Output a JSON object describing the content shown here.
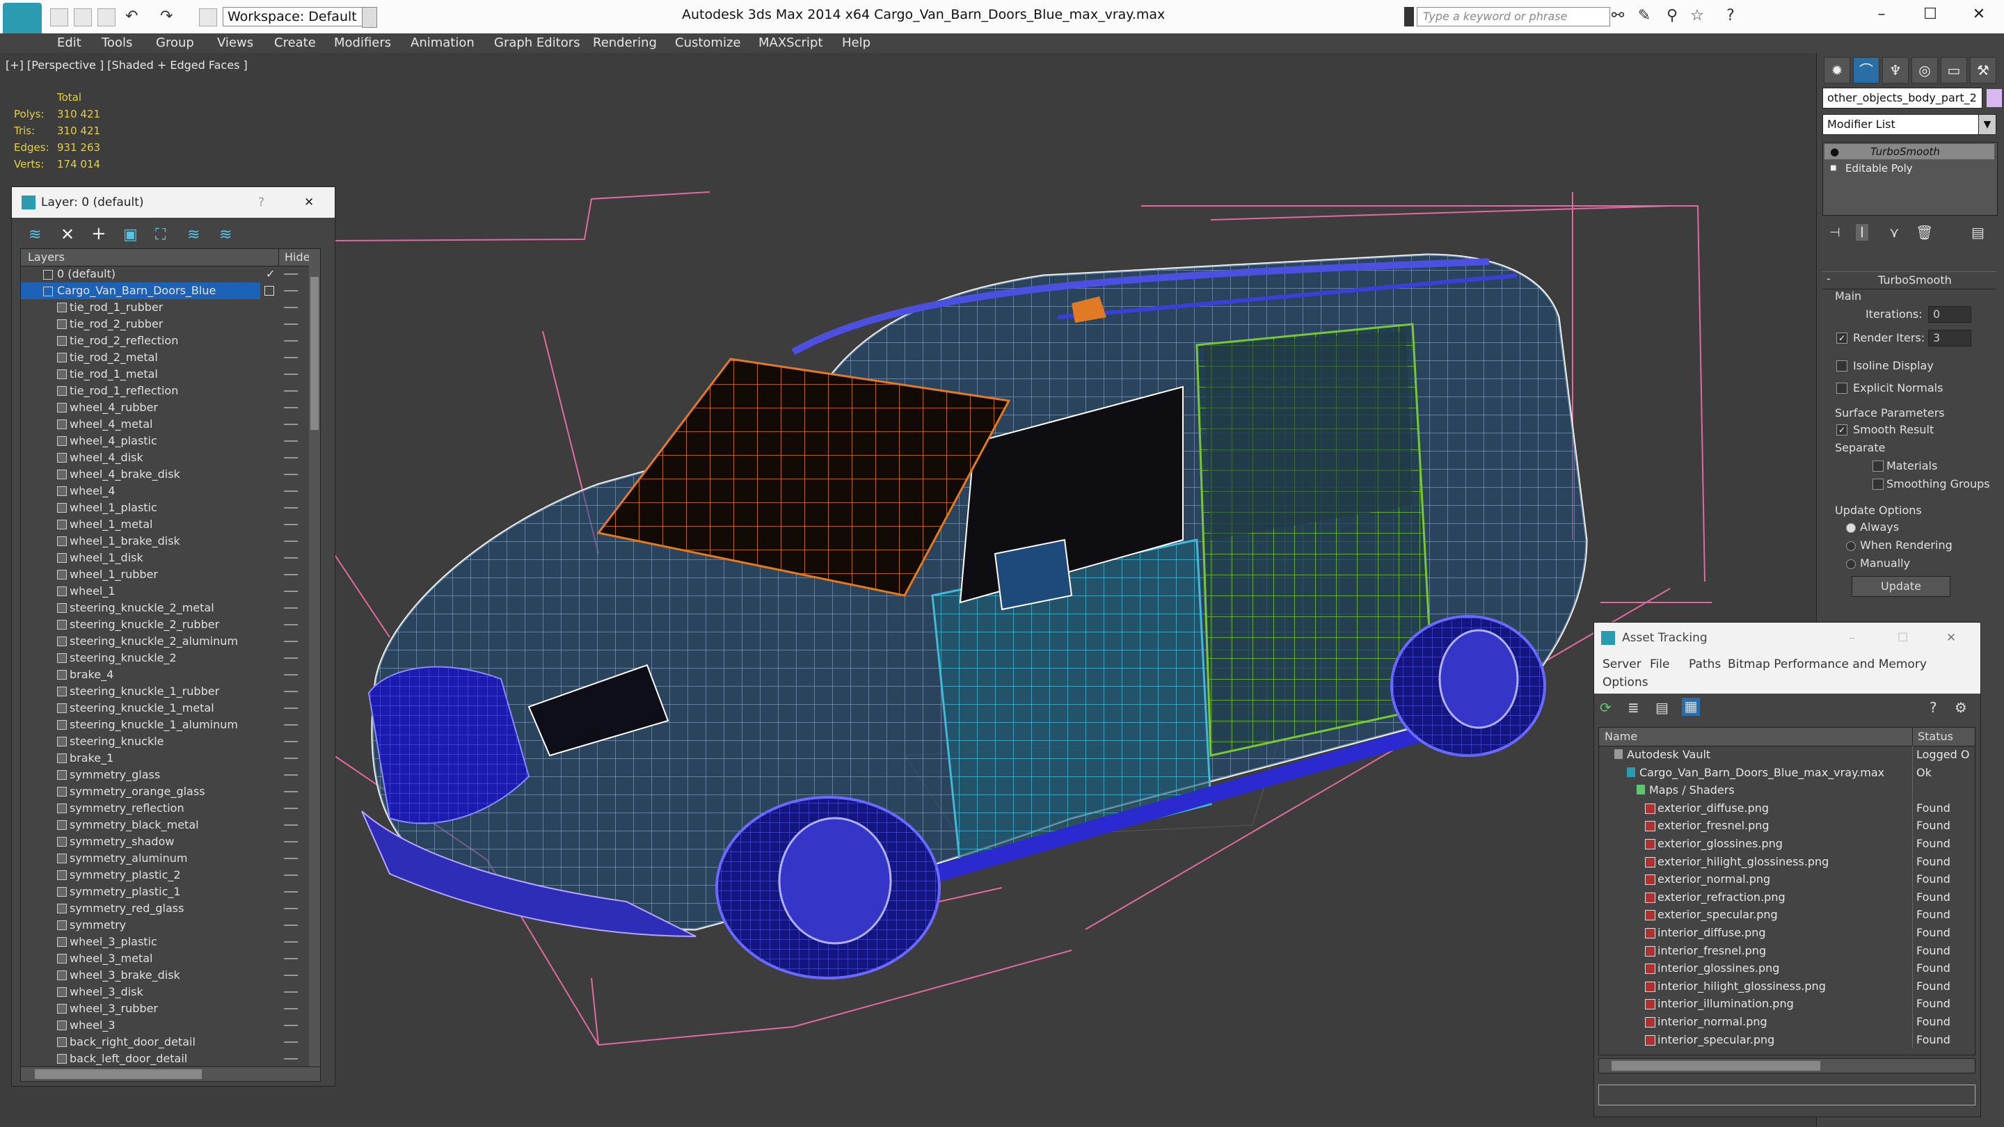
{
  "titlebar": {
    "workspace": "Workspace: Default",
    "app_title": "Autodesk 3ds Max  2014 x64       Cargo_Van_Barn_Doors_Blue_max_vray.max",
    "search_placeholder": "Type a keyword or phrase"
  },
  "menu": [
    "Edit",
    "Tools",
    "Group",
    "Views",
    "Create",
    "Modifiers",
    "Animation",
    "Graph Editors",
    "Rendering",
    "Customize",
    "MAXScript",
    "Help"
  ],
  "viewport": {
    "label": "[+] [Perspective ] [Shaded + Edged Faces ]",
    "stats_header": "Total",
    "stats": [
      {
        "k": "Polys:",
        "v": "310 421"
      },
      {
        "k": "Tris:",
        "v": "310 421"
      },
      {
        "k": "Edges:",
        "v": "931 263"
      },
      {
        "k": "Verts:",
        "v": "174 014"
      }
    ]
  },
  "layer_panel": {
    "title": "Layer: 0 (default)",
    "help": "?",
    "col_layers": "Layers",
    "col_hide": "Hide",
    "layers": [
      "0 (default)",
      "Cargo_Van_Barn_Doors_Blue",
      "tie_rod_1_rubber",
      "tie_rod_2_rubber",
      "tie_rod_2_reflection",
      "tie_rod_2_metal",
      "tie_rod_1_metal",
      "tie_rod_1_reflection",
      "wheel_4_rubber",
      "wheel_4_metal",
      "wheel_4_plastic",
      "wheel_4_disk",
      "wheel_4_brake_disk",
      "wheel_4",
      "wheel_1_plastic",
      "wheel_1_metal",
      "wheel_1_brake_disk",
      "wheel_1_disk",
      "wheel_1_rubber",
      "wheel_1",
      "steering_knuckle_2_metal",
      "steering_knuckle_2_rubber",
      "steering_knuckle_2_aluminum",
      "steering_knuckle_2",
      "brake_4",
      "steering_knuckle_1_rubber",
      "steering_knuckle_1_metal",
      "steering_knuckle_1_aluminum",
      "steering_knuckle",
      "brake_1",
      "symmetry_glass",
      "symmetry_orange_glass",
      "symmetry_reflection",
      "symmetry_black_metal",
      "symmetry_shadow",
      "symmetry_aluminum",
      "symmetry_plastic_2",
      "symmetry_plastic_1",
      "symmetry_red_glass",
      "symmetry",
      "wheel_3_plastic",
      "wheel_3_metal",
      "wheel_3_brake_disk",
      "wheel_3_disk",
      "wheel_3_rubber",
      "wheel_3",
      "back_right_door_detail",
      "back_left_door_detail"
    ]
  },
  "command_panel": {
    "object_name": "other_objects_body_part_2",
    "modifier_list": "Modifier List",
    "stack": [
      "TurboSmooth",
      "Editable Poly"
    ],
    "rollout_title": "TurboSmooth",
    "main": "Main",
    "iterations_label": "Iterations:",
    "iterations_value": "0",
    "render_iters_label": "Render Iters:",
    "render_iters_value": "3",
    "isoline": "Isoline Display",
    "explicit_normals": "Explicit Normals",
    "surface_params": "Surface Parameters",
    "smooth_result": "Smooth Result",
    "separate": "Separate",
    "materials": "Materials",
    "smoothing_groups": "Smoothing Groups",
    "update_options": "Update Options",
    "always": "Always",
    "when_rendering": "When Rendering",
    "manually": "Manually",
    "update_button": "Update"
  },
  "asset_tracking": {
    "title": "Asset Tracking",
    "menu": [
      "Server",
      "File",
      "Paths",
      "Bitmap Performance and Memory"
    ],
    "menu2": "Options",
    "col_name": "Name",
    "col_status": "Status",
    "rows": [
      {
        "name": "Autodesk Vault",
        "status": "Logged O",
        "indent": 1
      },
      {
        "name": "Cargo_Van_Barn_Doors_Blue_max_vray.max",
        "status": "Ok",
        "indent": 2
      },
      {
        "name": "Maps / Shaders",
        "status": "",
        "indent": 3
      },
      {
        "name": "exterior_diffuse.png",
        "status": "Found",
        "indent": 4
      },
      {
        "name": "exterior_fresnel.png",
        "status": "Found",
        "indent": 4
      },
      {
        "name": "exterior_glossines.png",
        "status": "Found",
        "indent": 4
      },
      {
        "name": "exterior_hilight_glossiness.png",
        "status": "Found",
        "indent": 4
      },
      {
        "name": "exterior_normal.png",
        "status": "Found",
        "indent": 4
      },
      {
        "name": "exterior_refraction.png",
        "status": "Found",
        "indent": 4
      },
      {
        "name": "exterior_specular.png",
        "status": "Found",
        "indent": 4
      },
      {
        "name": "interior_diffuse.png",
        "status": "Found",
        "indent": 4
      },
      {
        "name": "interior_fresnel.png",
        "status": "Found",
        "indent": 4
      },
      {
        "name": "interior_glossines.png",
        "status": "Found",
        "indent": 4
      },
      {
        "name": "interior_hilight_glossiness.png",
        "status": "Found",
        "indent": 4
      },
      {
        "name": "interior_illumination.png",
        "status": "Found",
        "indent": 4
      },
      {
        "name": "interior_normal.png",
        "status": "Found",
        "indent": 4
      },
      {
        "name": "interior_specular.png",
        "status": "Found",
        "indent": 4
      }
    ]
  },
  "colors": {
    "stats": "#e2d04a",
    "selection": "#1c63b7",
    "wire_blue": "#3a3fd6",
    "wire_orange": "#e07a24",
    "wire_green": "#78c835",
    "wire_cyan": "#41b9d4",
    "bbox_pink": "#e26aa0"
  }
}
